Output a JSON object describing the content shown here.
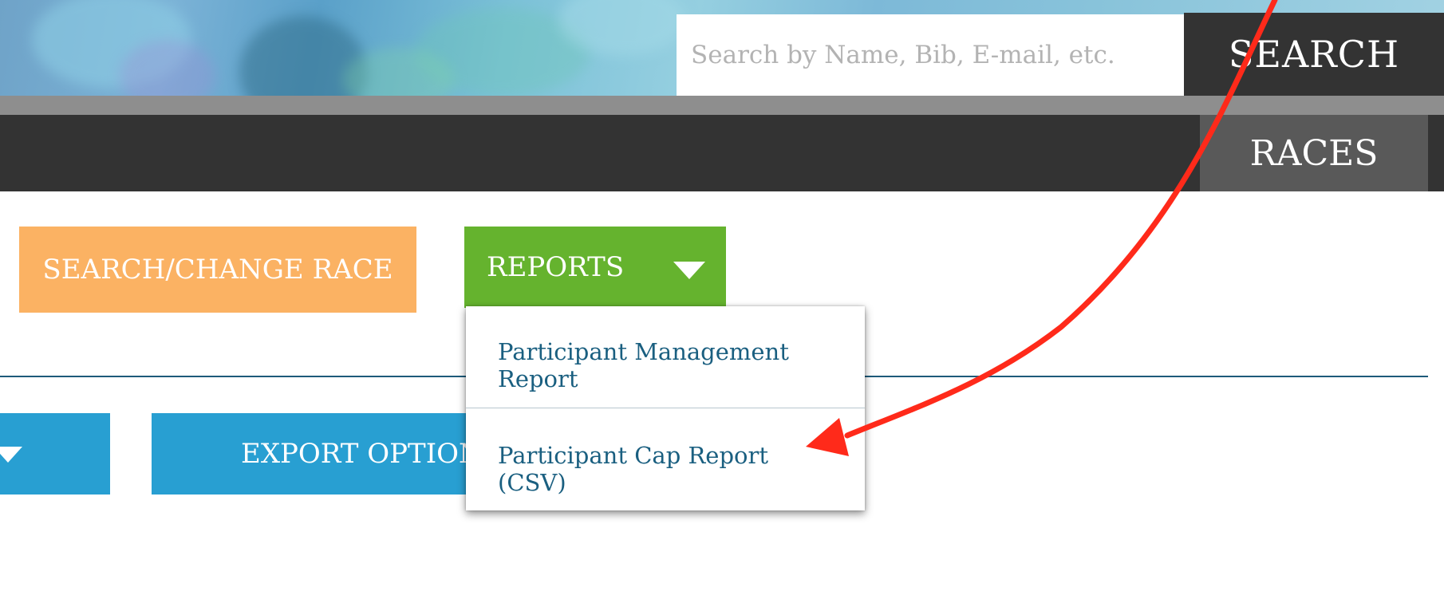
{
  "header": {
    "search": {
      "placeholder": "Search by Name, Bib, E-mail, etc.",
      "value": "",
      "button_label": "SEARCH"
    },
    "nav": {
      "races_label": "RACES"
    }
  },
  "actions": {
    "change_race_label": "SEARCH/CHANGE RACE",
    "reports_label": "REPORTS",
    "export_label": "EXPORT OPTIONS"
  },
  "reports_menu": {
    "items": [
      {
        "label": "Participant Management Report"
      },
      {
        "label": "Participant Cap Report (CSV)"
      }
    ]
  },
  "colors": {
    "accent_orange": "#fbb263",
    "accent_green": "#65b32e",
    "accent_blue": "#289fd2",
    "nav_dark": "#333333",
    "menu_text": "#1a5f80",
    "annotation_red": "#ff2a1a"
  },
  "icons": {
    "reports_caret": "caret-down-icon",
    "left_caret": "caret-down-icon",
    "annotation": "red-arrow-annotation"
  }
}
